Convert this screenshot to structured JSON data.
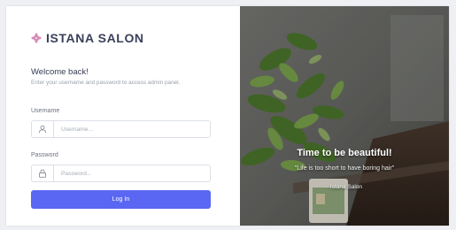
{
  "brand": {
    "name": "ISTANA SALON",
    "icon": "flower-icon",
    "accent_color": "#d98bb8"
  },
  "login": {
    "welcome": "Welcome back!",
    "subtitle": "Enter your username and password to access admin panel.",
    "username": {
      "label": "Username",
      "placeholder": "Username...",
      "value": "",
      "icon": "user-icon"
    },
    "password": {
      "label": "Password",
      "placeholder": "Password...",
      "value": "",
      "icon": "lock-icon"
    },
    "submit_label": "Log In",
    "button_color": "#5a67f2"
  },
  "hero": {
    "title": "Time to be beautiful!",
    "quote": "\"Life is too short to have boring hair\"",
    "author": "- Istana Salon"
  }
}
